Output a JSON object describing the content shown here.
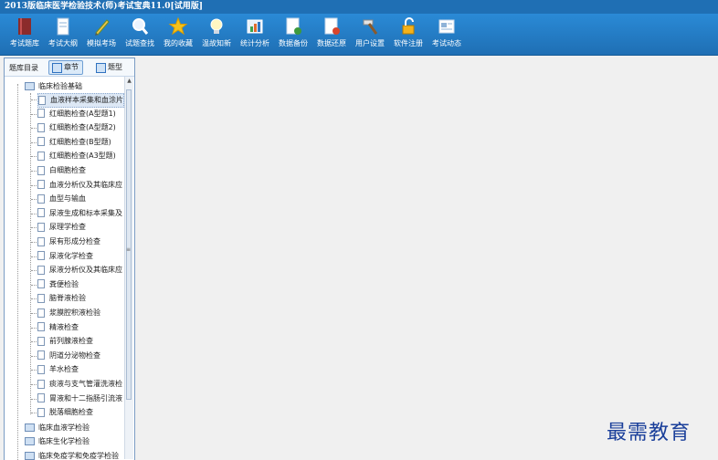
{
  "window": {
    "title": "2013版临床医学检验技术(师)考试宝典11.0[试用版]"
  },
  "toolbar": {
    "items": [
      {
        "label": "考试题库",
        "icon": "book-icon"
      },
      {
        "label": "考试大纲",
        "icon": "document-icon"
      },
      {
        "label": "模拟考场",
        "icon": "pencil-icon"
      },
      {
        "label": "试题查找",
        "icon": "magnifier-icon"
      },
      {
        "label": "我的收藏",
        "icon": "star-icon"
      },
      {
        "label": "温故知新",
        "icon": "lightbulb-icon"
      },
      {
        "label": "统计分析",
        "icon": "chart-icon"
      },
      {
        "label": "数据备份",
        "icon": "backup-icon"
      },
      {
        "label": "数据还原",
        "icon": "restore-icon"
      },
      {
        "label": "用户设置",
        "icon": "hammer-icon"
      },
      {
        "label": "软件注册",
        "icon": "lock-icon"
      },
      {
        "label": "考试动态",
        "icon": "news-icon"
      }
    ]
  },
  "left_panel": {
    "title": "题库目录",
    "tabs": [
      {
        "label": "章节",
        "active": true
      },
      {
        "label": "题型",
        "active": false
      }
    ],
    "tree": {
      "root": "临床检验基础",
      "children": [
        "血液样本采集和血涂片",
        "红细胞检查(A型题1)",
        "红细胞检查(A型题2)",
        "红细胞检查(B型题)",
        "红细胞检查(A3型题)",
        "白细胞检查",
        "血液分析仪及其临床应",
        "血型与输血",
        "尿液生成和标本采集及",
        "尿理学检查",
        "尿有形成分检查",
        "尿液化学检查",
        "尿液分析仪及其临床应",
        "粪便检验",
        "脑脊液检验",
        "浆膜腔积液检验",
        "精液检查",
        "前列腺液检查",
        "阴道分泌物检查",
        "羊水检查",
        "痰液与支气管灌洗液检",
        "胃液和十二指肠引流液",
        "脱落细胞检查"
      ],
      "siblings": [
        "临床血液学检验",
        "临床生化学检验",
        "临床免疫学和免疫学检验"
      ]
    }
  },
  "watermark": "最需教育"
}
